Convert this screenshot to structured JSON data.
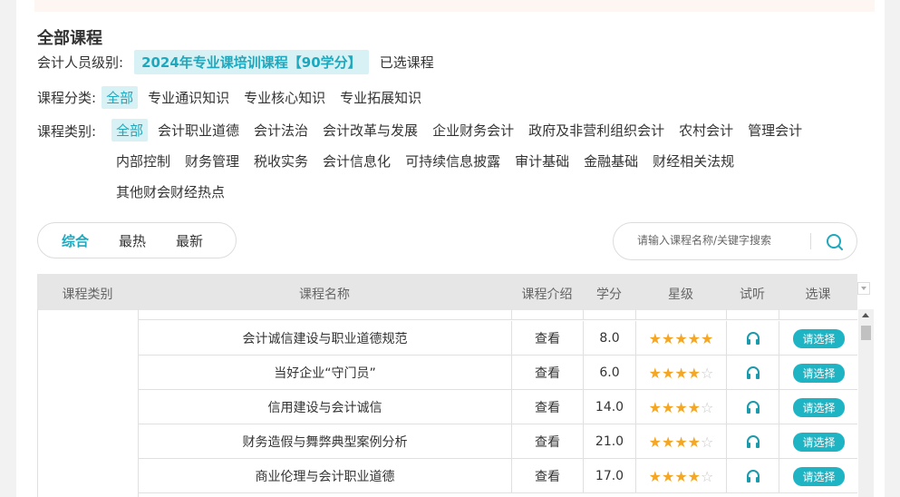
{
  "section_title": "全部课程",
  "level": {
    "label": "会计人员级别:",
    "value": "2024年专业课培训课程【90学分】",
    "selected_link": "已选课程"
  },
  "category": {
    "label": "课程分类:",
    "options": [
      "全部",
      "专业通识知识",
      "专业核心知识",
      "专业拓展知识"
    ],
    "active": 0
  },
  "type": {
    "label": "课程类别:",
    "options": [
      "全部",
      "会计职业道德",
      "会计法治",
      "会计改革与发展",
      "企业财务会计",
      "政府及非营利组织会计",
      "农村会计",
      "管理会计",
      "内部控制",
      "财务管理",
      "税收实务",
      "会计信息化",
      "可持续信息披露",
      "审计基础",
      "金融基础",
      "财经相关法规",
      "其他财会财经热点"
    ],
    "active": 0
  },
  "sort": {
    "tabs": [
      "综合",
      "最热",
      "最新"
    ],
    "active": 0
  },
  "search": {
    "placeholder": "请输入课程名称/关键字搜索",
    "icon": "search-icon"
  },
  "table": {
    "headers": [
      "课程类别",
      "课程名称",
      "课程介绍",
      "学分",
      "星级",
      "试听",
      "选课"
    ],
    "rows": [
      {
        "name": "会计诚信建设与职业道德规范",
        "intro": "查看",
        "credit": "8.0",
        "stars": 5,
        "select": "请选择"
      },
      {
        "name": "当好企业“守门员”",
        "intro": "查看",
        "credit": "6.0",
        "stars": 4,
        "select": "请选择"
      },
      {
        "name": "信用建设与会计诚信",
        "intro": "查看",
        "credit": "14.0",
        "stars": 4,
        "select": "请选择"
      },
      {
        "name": "财务造假与舞弊典型案例分析",
        "intro": "查看",
        "credit": "21.0",
        "stars": 4,
        "select": "请选择"
      },
      {
        "name": "商业伦理与会计职业道德",
        "intro": "查看",
        "credit": "17.0",
        "stars": 4,
        "select": "请选择"
      }
    ]
  },
  "colors": {
    "accent": "#1fa8bd",
    "button": "#1fb4c4",
    "star": "#f5a623",
    "chip_bg": "#d7f1f4"
  }
}
